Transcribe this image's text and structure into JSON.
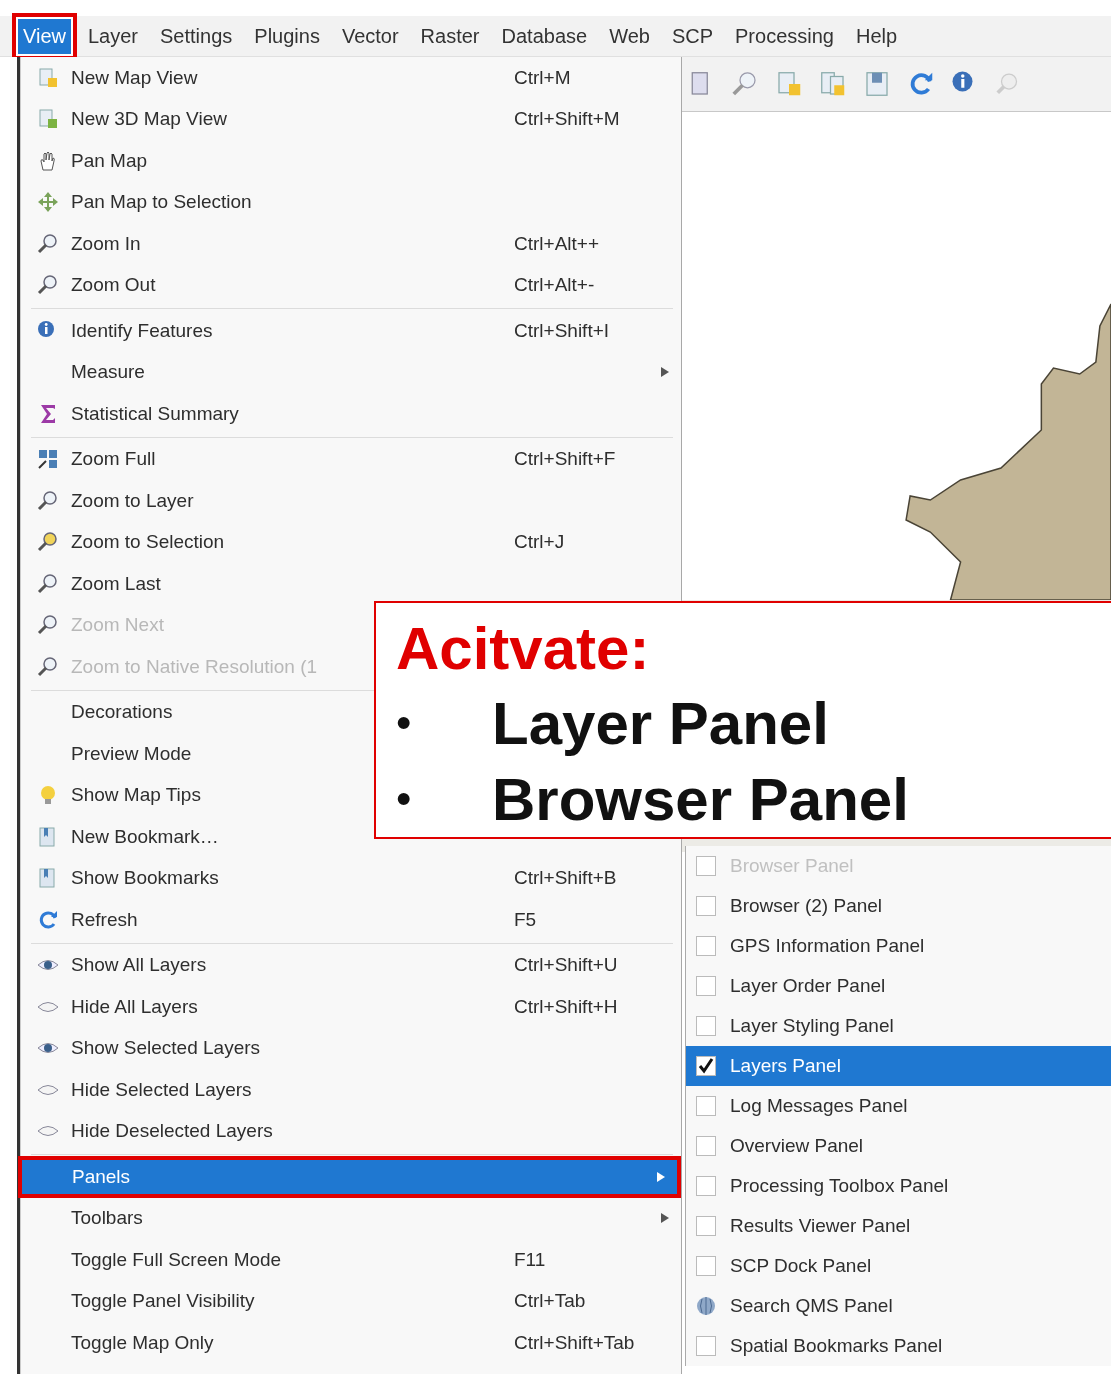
{
  "menu_bar": [
    {
      "label": "View",
      "selected": true,
      "annotated": true
    },
    {
      "label": "Layer",
      "selected": false,
      "annotated": false
    },
    {
      "label": "Settings",
      "selected": false,
      "annotated": false
    },
    {
      "label": "Plugins",
      "selected": false,
      "annotated": false
    },
    {
      "label": "Vector",
      "selected": false,
      "annotated": false
    },
    {
      "label": "Raster",
      "selected": false,
      "annotated": false
    },
    {
      "label": "Database",
      "selected": false,
      "annotated": false
    },
    {
      "label": "Web",
      "selected": false,
      "annotated": false
    },
    {
      "label": "SCP",
      "selected": false,
      "annotated": false
    },
    {
      "label": "Processing",
      "selected": false,
      "annotated": false
    },
    {
      "label": "Help",
      "selected": false,
      "annotated": false
    }
  ],
  "view_menu": {
    "items": [
      {
        "kind": "item",
        "label": "New Map View",
        "shortcut": "Ctrl+M",
        "icon": true,
        "submenu": false,
        "disabled": false,
        "selected": false,
        "annotated": false
      },
      {
        "kind": "item",
        "label": "New 3D Map View",
        "shortcut": "Ctrl+Shift+M",
        "icon": true,
        "submenu": false,
        "disabled": false,
        "selected": false,
        "annotated": false
      },
      {
        "kind": "item",
        "label": "Pan Map",
        "icon": true,
        "submenu": false,
        "disabled": false,
        "selected": false,
        "annotated": false
      },
      {
        "kind": "item",
        "label": "Pan Map to Selection",
        "icon": true,
        "submenu": false,
        "disabled": false,
        "selected": false,
        "annotated": false
      },
      {
        "kind": "item",
        "label": "Zoom In",
        "shortcut": "Ctrl+Alt++",
        "icon": true,
        "submenu": false,
        "disabled": false,
        "selected": false,
        "annotated": false
      },
      {
        "kind": "item",
        "label": "Zoom Out",
        "shortcut": "Ctrl+Alt+-",
        "icon": true,
        "submenu": false,
        "disabled": false,
        "selected": false,
        "annotated": false
      },
      {
        "kind": "separator"
      },
      {
        "kind": "item",
        "label": "Identify Features",
        "shortcut": "Ctrl+Shift+I",
        "icon": true,
        "submenu": false,
        "disabled": false,
        "selected": false,
        "annotated": false
      },
      {
        "kind": "item",
        "label": "Measure",
        "icon": false,
        "submenu": true,
        "disabled": false,
        "selected": false,
        "annotated": false
      },
      {
        "kind": "item",
        "label": "Statistical Summary",
        "icon": true,
        "submenu": false,
        "disabled": false,
        "selected": false,
        "annotated": false
      },
      {
        "kind": "separator"
      },
      {
        "kind": "item",
        "label": "Zoom Full",
        "shortcut": "Ctrl+Shift+F",
        "icon": true,
        "submenu": false,
        "disabled": false,
        "selected": false,
        "annotated": false
      },
      {
        "kind": "item",
        "label": "Zoom to Layer",
        "icon": true,
        "submenu": false,
        "disabled": false,
        "selected": false,
        "annotated": false
      },
      {
        "kind": "item",
        "label": "Zoom to Selection",
        "shortcut": "Ctrl+J",
        "icon": true,
        "submenu": false,
        "disabled": false,
        "selected": false,
        "annotated": false
      },
      {
        "kind": "item",
        "label": "Zoom Last",
        "icon": true,
        "submenu": false,
        "disabled": false,
        "selected": false,
        "annotated": false
      },
      {
        "kind": "item",
        "label": "Zoom Next",
        "icon": true,
        "submenu": false,
        "disabled": true,
        "selected": false,
        "annotated": false
      },
      {
        "kind": "item",
        "label": "Zoom to Native Resolution (1",
        "icon": true,
        "submenu": false,
        "disabled": true,
        "selected": false,
        "annotated": false
      },
      {
        "kind": "separator"
      },
      {
        "kind": "item",
        "label": "Decorations",
        "icon": false,
        "disabled": false,
        "selected": false,
        "annotated": false
      },
      {
        "kind": "item",
        "label": "Preview Mode",
        "icon": false,
        "disabled": false,
        "selected": false,
        "annotated": false
      },
      {
        "kind": "item",
        "label": "Show Map Tips",
        "icon": true,
        "submenu": false,
        "disabled": false,
        "selected": false,
        "annotated": false
      },
      {
        "kind": "item",
        "label": "New Bookmark…",
        "icon": true,
        "submenu": false,
        "disabled": false,
        "selected": false,
        "annotated": false
      },
      {
        "kind": "item",
        "label": "Show Bookmarks",
        "shortcut": "Ctrl+Shift+B",
        "icon": true,
        "submenu": false,
        "disabled": false,
        "selected": false,
        "annotated": false
      },
      {
        "kind": "item",
        "label": "Refresh",
        "shortcut": "F5",
        "icon": true,
        "submenu": false,
        "disabled": false,
        "selected": false,
        "annotated": false
      },
      {
        "kind": "separator"
      },
      {
        "kind": "item",
        "label": "Show All Layers",
        "shortcut": "Ctrl+Shift+U",
        "icon": true,
        "submenu": false,
        "disabled": false,
        "selected": false,
        "annotated": false
      },
      {
        "kind": "item",
        "label": "Hide All Layers",
        "shortcut": "Ctrl+Shift+H",
        "icon": true,
        "submenu": false,
        "disabled": false,
        "selected": false,
        "annotated": false
      },
      {
        "kind": "item",
        "label": "Show Selected Layers",
        "icon": true,
        "submenu": false,
        "disabled": false,
        "selected": false,
        "annotated": false
      },
      {
        "kind": "item",
        "label": "Hide Selected Layers",
        "icon": true,
        "submenu": false,
        "disabled": false,
        "selected": false,
        "annotated": false
      },
      {
        "kind": "item",
        "label": "Hide Deselected Layers",
        "icon": true,
        "submenu": false,
        "disabled": false,
        "selected": false,
        "annotated": false
      },
      {
        "kind": "separator"
      },
      {
        "kind": "item",
        "label": "Panels",
        "icon": false,
        "submenu": true,
        "disabled": false,
        "selected": true,
        "annotated": true
      },
      {
        "kind": "item",
        "label": "Toolbars",
        "icon": false,
        "submenu": true,
        "disabled": false,
        "selected": false,
        "annotated": false
      },
      {
        "kind": "item",
        "label": "Toggle Full Screen Mode",
        "shortcut": "F11",
        "icon": false,
        "submenu": false,
        "disabled": false,
        "selected": false,
        "annotated": false
      },
      {
        "kind": "item",
        "label": "Toggle Panel Visibility",
        "shortcut": "Ctrl+Tab",
        "icon": false,
        "submenu": false,
        "disabled": false,
        "selected": false,
        "annotated": false
      },
      {
        "kind": "item",
        "label": "Toggle Map Only",
        "shortcut": "Ctrl+Shift+Tab",
        "icon": false,
        "submenu": false,
        "disabled": false,
        "selected": false,
        "annotated": false
      }
    ]
  },
  "panels_submenu": {
    "items": [
      {
        "kind": "checkbox",
        "label": "Browser Panel",
        "checked": false,
        "disabled": true,
        "selected": false
      },
      {
        "kind": "checkbox",
        "label": "Browser (2) Panel",
        "checked": false,
        "disabled": false,
        "selected": false
      },
      {
        "kind": "checkbox",
        "label": "GPS Information Panel",
        "checked": false,
        "disabled": false,
        "selected": false
      },
      {
        "kind": "checkbox",
        "label": "Layer Order Panel",
        "checked": false,
        "disabled": false,
        "selected": false
      },
      {
        "kind": "checkbox",
        "label": "Layer Styling Panel",
        "checked": false,
        "disabled": false,
        "selected": false
      },
      {
        "kind": "checkbox",
        "label": "Layers Panel",
        "checked": true,
        "disabled": false,
        "selected": true
      },
      {
        "kind": "checkbox",
        "label": "Log Messages Panel",
        "checked": false,
        "disabled": false,
        "selected": false
      },
      {
        "kind": "checkbox",
        "label": "Overview Panel",
        "checked": false,
        "disabled": false,
        "selected": false
      },
      {
        "kind": "checkbox",
        "label": "Processing Toolbox Panel",
        "checked": false,
        "disabled": false,
        "selected": false
      },
      {
        "kind": "checkbox",
        "label": "Results Viewer Panel",
        "checked": false,
        "disabled": false,
        "selected": false
      },
      {
        "kind": "checkbox",
        "label": "SCP Dock Panel",
        "checked": false,
        "disabled": false,
        "selected": false
      },
      {
        "kind": "icon",
        "label": "Search QMS Panel",
        "disabled": false,
        "selected": false
      },
      {
        "kind": "checkbox",
        "label": "Spatial Bookmarks Panel",
        "checked": false,
        "disabled": false,
        "selected": false
      }
    ]
  },
  "annotation": {
    "title": "Acitvate:",
    "bullets": [
      {
        "bullet": "•",
        "text": "Layer Panel"
      },
      {
        "bullet": "•",
        "text": "Browser Panel"
      }
    ]
  }
}
